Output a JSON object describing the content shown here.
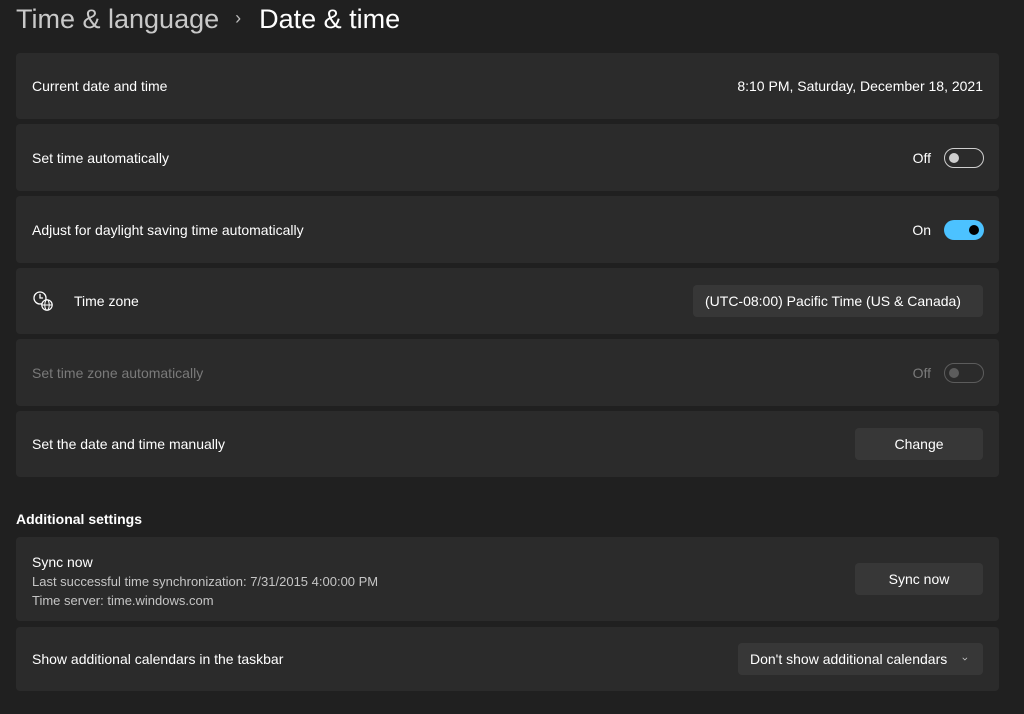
{
  "breadcrumb": {
    "parent": "Time & language",
    "separator": "›",
    "current": "Date & time"
  },
  "current_datetime": {
    "label": "Current date and time",
    "value": "8:10 PM, Saturday, December 18, 2021"
  },
  "set_time_auto": {
    "label": "Set time automatically",
    "state": "Off",
    "on": false
  },
  "dst_auto": {
    "label": "Adjust for daylight saving time automatically",
    "state": "On",
    "on": true
  },
  "time_zone": {
    "label": "Time zone",
    "icon": "globe-clock-icon",
    "selected": "(UTC-08:00) Pacific Time (US & Canada)"
  },
  "set_tz_auto": {
    "label": "Set time zone automatically",
    "state": "Off",
    "on": false,
    "disabled": true
  },
  "manual": {
    "label": "Set the date and time manually",
    "button": "Change"
  },
  "additional": {
    "title": "Additional settings"
  },
  "sync": {
    "title": "Sync now",
    "last_sync": "Last successful time synchronization: 7/31/2015 4:00:00 PM",
    "server": "Time server: time.windows.com",
    "button": "Sync now"
  },
  "calendars": {
    "label": "Show additional calendars in the taskbar",
    "selected": "Don't show additional calendars"
  },
  "colors": {
    "background": "#202020",
    "card": "#2b2b2b",
    "control": "#373737",
    "accent": "#4cc2ff"
  }
}
